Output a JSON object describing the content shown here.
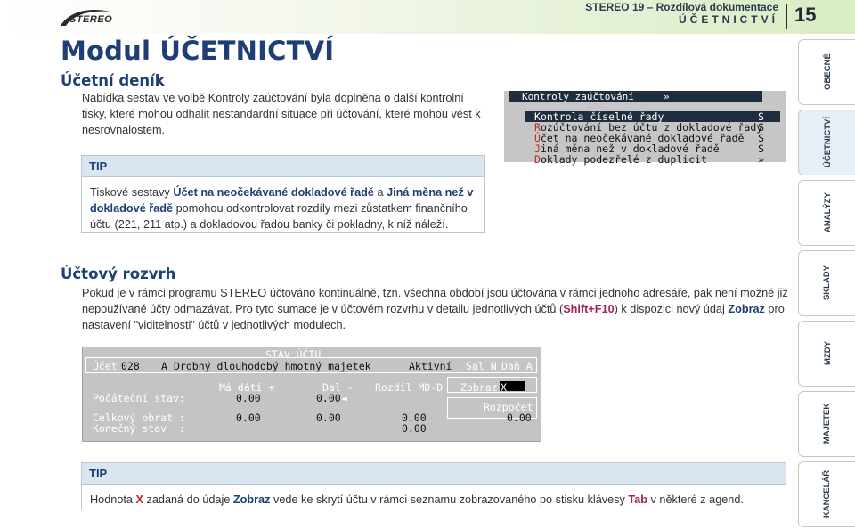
{
  "header": {
    "logo_text": "STEREO",
    "doc_title": "STEREO 19 – Rozdílová dokumentace",
    "module": "ÚČETNICTVÍ",
    "page": "15"
  },
  "module_title": "Modul ÚČETNICTVÍ",
  "section1": {
    "title": "Účetní deník",
    "text": "Nabídka sestav ve volbě Kontroly zaúčtování byla doplněna o další kontrolní tisky, které mohou odhalit nestandardní situace při účtování, které mohou vést k nesrovnalostem."
  },
  "tip1": {
    "head": "TIP",
    "t1": "Tiskové sestavy ",
    "h1": "Účet na neočekávané dokladové řadě",
    "t2": " a ",
    "h2": "Jiná měna než v dokladové řadě",
    "t3": " pomohou odkontrolovat rozdíly mezi zůstatkem finančního účtu (221, 211 atp.) a dokladovou řadou banky či pokladny, k níž náleží."
  },
  "screen1": {
    "menu_bar": "Kontroly zaúčtování     »",
    "items": [
      {
        "first": "K",
        "rest": "ontrola číselné řady",
        "flag": "S"
      },
      {
        "first": "R",
        "rest": "ozúčtování bez účtu z dokladové řady",
        "flag": "S"
      },
      {
        "first": "Ú",
        "rest": "čet na neočekávané dokladové řadě",
        "flag": "S"
      },
      {
        "first": "J",
        "rest": "iná měna než v dokladové řadě",
        "flag": "S"
      },
      {
        "first": "D",
        "rest": "oklady podezřelé z duplicit",
        "flag": "»"
      }
    ]
  },
  "section2": {
    "title": "Účtový rozvrh",
    "t1": "Pokud je v rámci programu STEREO účtováno kontinuálně, tzn. všechna období jsou účtována v rámci jednoho adresáře, pak není možné již nepoužívané účty odmazávat. Pro tyto sumace je v účtovém rozvrhu v detailu jednotlivých účtů (",
    "k1": "Shift+F10",
    "t2": ") k dispozici nový údaj ",
    "k2": "Zobraz",
    "t3": " pro nastavení \"viditelnosti\" účtů v jednotlivých modulech."
  },
  "screen2": {
    "title": "STAV ÚČTU",
    "l_ucet": "Účet",
    "ucet_num": "028",
    "ucet_flag": "A",
    "ucet_name": "Drobný dlouhodobý hmotný majetek",
    "aktivni": "Aktivní",
    "sal": "Sal N",
    "dan": "Daň A",
    "h_md": "Má dáti +",
    "h_dal": "Dal -",
    "h_rozdil": "Rozdíl MD-D",
    "zobraz_label": "Zobraz",
    "zobraz_val": "X",
    "l_pocatecni": "Počáteční stav:",
    "poc_md": "0.00",
    "poc_dal": "0.00",
    "poc_arrow": "◄",
    "rozpocet": "Rozpočet",
    "rozpocet_val": "0.00",
    "l_celkovy": "Celkový obrat :",
    "cel_md": "0.00",
    "cel_dal": "0.00",
    "cel_rozdil": "0.00",
    "l_konecny": "Konečný stav  :",
    "kon_rozdil": "0.00"
  },
  "tip2": {
    "head": "TIP",
    "t1": "Hodnota ",
    "x": "X",
    "t2": " zadaná do údaje ",
    "z": "Zobraz",
    "t3": " vede ke skrytí účtu v rámci seznamu zobrazovaného po stisku klávesy ",
    "tab": "Tab",
    "t4": " v některé z agend."
  },
  "tabs": [
    "OBECNÉ",
    "ÚČETNICTVÍ",
    "ANALÝZY",
    "SKLADY",
    "MZDY",
    "MAJETEK",
    "KANCELÁŘ"
  ]
}
